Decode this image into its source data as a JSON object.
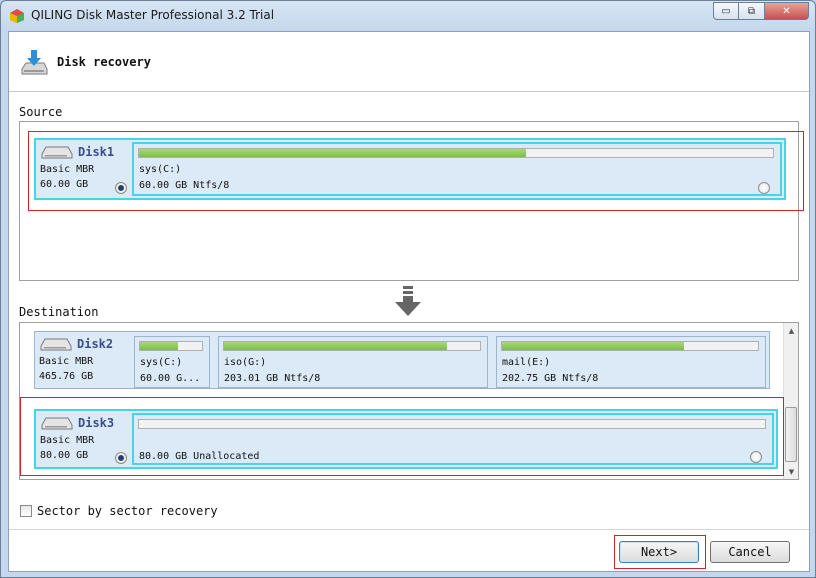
{
  "window": {
    "title": "QILING Disk Master Professional 3.2 Trial",
    "controls": {
      "minimize": "▭",
      "maximize": "⧉",
      "close": "✕"
    }
  },
  "header": {
    "title": "Disk recovery",
    "icon": "disk-download-icon"
  },
  "source": {
    "label": "Source",
    "disk": {
      "name": "Disk1",
      "type": "Basic MBR",
      "size": "60.00 GB",
      "selected": true,
      "partitions": [
        {
          "name": "sys(C:)",
          "size": "60.00 GB Ntfs/8",
          "used_fraction": 0.61,
          "selected": false
        }
      ]
    }
  },
  "destination": {
    "label": "Destination",
    "disks": [
      {
        "name": "Disk2",
        "type": "Basic MBR",
        "size": "465.76 GB",
        "partitions": [
          {
            "name": "sys(C:)",
            "size": "60.00 G...",
            "used_fraction": 0.62
          },
          {
            "name": "iso(G:)",
            "size": "203.01 GB Ntfs/8",
            "used_fraction": 0.87
          },
          {
            "name": "mail(E:)",
            "size": "202.75 GB Ntfs/8",
            "used_fraction": 0.71
          }
        ]
      },
      {
        "name": "Disk3",
        "type": "Basic MBR",
        "size": "80.00 GB",
        "selected": true,
        "partitions": [
          {
            "name": "",
            "size": "80.00 GB Unallocated",
            "used_fraction": 0.0,
            "selected": false
          }
        ]
      }
    ]
  },
  "options": {
    "sector_by_sector_label": "Sector by sector recovery",
    "sector_by_sector_checked": false
  },
  "buttons": {
    "next": "Next>",
    "cancel": "Cancel"
  },
  "colors": {
    "accent": "#42d7e6",
    "highlight": "#c8262c",
    "usage": "#7dbd4d"
  }
}
